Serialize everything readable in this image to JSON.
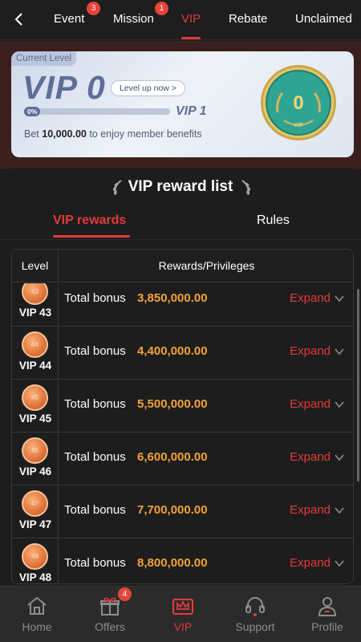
{
  "nav": {
    "tabs": [
      {
        "label": "Event",
        "badge": "3"
      },
      {
        "label": "Mission",
        "badge": "1"
      },
      {
        "label": "VIP",
        "badge": ""
      },
      {
        "label": "Rebate",
        "badge": ""
      },
      {
        "label": "Unclaimed",
        "badge": ""
      }
    ],
    "active_tab": "VIP"
  },
  "card": {
    "tag": "Current Level",
    "current_level": "VIP 0",
    "level_up_label": "Level up now >",
    "progress_percent": 0,
    "progress_label": "0%",
    "next_level": "VIP 1",
    "bet_prefix": "Bet ",
    "bet_amount": "10,000.00",
    "bet_suffix": " to enjoy member benefits",
    "coin_number": "0",
    "coin_label": "VIP"
  },
  "rewards": {
    "title": "VIP reward list",
    "tabs": [
      "VIP rewards",
      "Rules"
    ],
    "columns": [
      "Level",
      "Rewards/Privileges"
    ],
    "rows": [
      {
        "level": "VIP 43",
        "coin": "43",
        "label": "Total bonus",
        "value": "3,850,000.00",
        "action": "Expand"
      },
      {
        "level": "VIP 44",
        "coin": "44",
        "label": "Total bonus",
        "value": "4,400,000.00",
        "action": "Expand"
      },
      {
        "level": "VIP 45",
        "coin": "45",
        "label": "Total bonus",
        "value": "5,500,000.00",
        "action": "Expand"
      },
      {
        "level": "VIP 46",
        "coin": "46",
        "label": "Total bonus",
        "value": "6,600,000.00",
        "action": "Expand"
      },
      {
        "level": "VIP 47",
        "coin": "47",
        "label": "Total bonus",
        "value": "7,700,000.00",
        "action": "Expand"
      },
      {
        "level": "VIP 48",
        "coin": "48",
        "label": "Total bonus",
        "value": "8,800,000.00",
        "action": "Expand"
      }
    ]
  },
  "bottom_nav": {
    "items": [
      {
        "label": "Home",
        "icon": "home-icon",
        "badge": ""
      },
      {
        "label": "Offers",
        "icon": "gift-icon",
        "badge": "4"
      },
      {
        "label": "VIP",
        "icon": "crown-icon",
        "badge": ""
      },
      {
        "label": "Support",
        "icon": "headset-icon",
        "badge": ""
      },
      {
        "label": "Profile",
        "icon": "user-icon",
        "badge": ""
      }
    ],
    "active": "VIP"
  },
  "colors": {
    "accent": "#e33a3a",
    "bonus": "#f2a23a",
    "background": "#1b1b1b"
  }
}
